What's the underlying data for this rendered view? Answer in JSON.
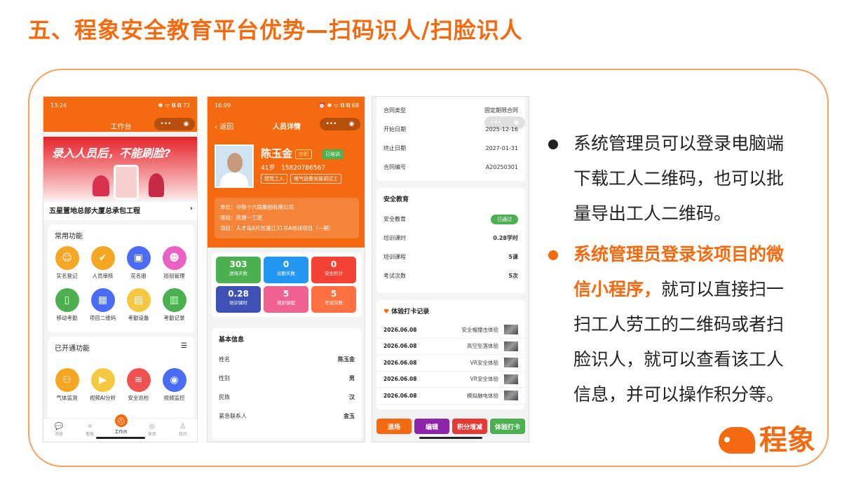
{
  "title": "五、程象安全教育平台优势—扫码识人/扫脸识人",
  "phone1": {
    "time": "13:24",
    "status_icons": "✽ ᯤ 𝗹𝗹 𝗹𝗹 73",
    "header_title": "工作台",
    "banner_text": "录入人员后，不能刷脸?",
    "project": "五星置地总部大厦总承包工程",
    "common_title": "常用功能",
    "common": [
      {
        "label": "实名登记",
        "color": "#f5a623",
        "icon": "☺"
      },
      {
        "label": "人员审核",
        "color": "#f5a623",
        "icon": "✔"
      },
      {
        "label": "花名册",
        "color": "#4a6cf7",
        "icon": "▣"
      },
      {
        "label": "班组管理",
        "color": "#e862c4",
        "icon": "☻"
      },
      {
        "label": "移动考勤",
        "color": "#4caf50",
        "icon": "▯"
      },
      {
        "label": "项目二维码",
        "color": "#4a6cf7",
        "icon": "▦"
      },
      {
        "label": "考勤设备",
        "color": "#f5c842",
        "icon": "▤"
      },
      {
        "label": "考勤记录",
        "color": "#4caf50",
        "icon": "▥"
      }
    ],
    "opened_title": "已开通功能",
    "opened": [
      {
        "label": "气体监测",
        "color": "#f5a623",
        "icon": "⚇"
      },
      {
        "label": "视频AI分析",
        "color": "#f5c842",
        "icon": "▶"
      },
      {
        "label": "安全巡检",
        "color": "#ef5350",
        "icon": "≋"
      },
      {
        "label": "视频监控",
        "color": "#4a6cf7",
        "icon": "◉"
      }
    ],
    "tabs": [
      {
        "label": "消息",
        "icon": "💬"
      },
      {
        "label": "看板",
        "icon": "⌗"
      },
      {
        "label": "工作台",
        "icon": "⛑"
      },
      {
        "label": "发现",
        "icon": "◎"
      },
      {
        "label": "我的",
        "icon": "♙"
      }
    ]
  },
  "phone2": {
    "time": "16:09",
    "status_icons": "⏰ ✽ ᯤ 𝗹𝗹 𝗹𝗹 68",
    "back": "返回",
    "nav_title": "人员详情",
    "name": "陈玉金",
    "status1": "在职",
    "status2": "已培训",
    "age": "41岁",
    "phone": "15820786567",
    "tag1": "建筑工人",
    "tag2": "电气设备安装调试工",
    "unit": "单位：中铁十六局集团有限公司",
    "team": "班组：房建一工班",
    "project": "项目：人才岛A片区蓬江31号A地块项目（一期）",
    "stats": [
      {
        "v": "303",
        "l": "进场天数",
        "c": "#4caf50"
      },
      {
        "v": "0",
        "l": "出勤天数",
        "c": "#2196f3"
      },
      {
        "v": "0",
        "l": "安全积分",
        "c": "#f44336"
      },
      {
        "v": "0.28",
        "l": "培训课时",
        "c": "#3f51b5"
      },
      {
        "v": "5",
        "l": "培训课程",
        "c": "#f06292"
      },
      {
        "v": "5",
        "l": "考试次数",
        "c": "#ff7043"
      }
    ],
    "info_title": "基本信息",
    "info": [
      {
        "k": "姓名",
        "v": "陈玉金"
      },
      {
        "k": "性别",
        "v": "男"
      },
      {
        "k": "民族",
        "v": "汉"
      },
      {
        "k": "紧急联系人",
        "v": "金玉"
      }
    ]
  },
  "phone3": {
    "contract": [
      {
        "k": "合同类型",
        "v": "固定期限合同"
      },
      {
        "k": "开始日期",
        "v": "2025-12-16"
      },
      {
        "k": "终止日期",
        "v": "2027-01-31"
      },
      {
        "k": "合同编号",
        "v": "A20250301"
      }
    ],
    "edu_title": "安全教育",
    "edu_first_k": "安全教育",
    "edu_first_v": "已通过",
    "edu": [
      {
        "k": "培训课时",
        "v": "0.28学时"
      },
      {
        "k": "培训课程",
        "v": "5课"
      },
      {
        "k": "考试次数",
        "v": "5次"
      }
    ],
    "punch_title": "体验打卡记录",
    "punch": [
      {
        "d": "2026.06.08",
        "n": "安全帽撞击体验"
      },
      {
        "d": "2026.06.08",
        "n": "高空坠落体验"
      },
      {
        "d": "2026.06.08",
        "n": "VR安全体验"
      },
      {
        "d": "2026.06.08",
        "n": "VR安全体验"
      },
      {
        "d": "2026.06.08",
        "n": "模拟触电体验"
      }
    ],
    "buttons": [
      {
        "label": "退场",
        "color": "#f36a10"
      },
      {
        "label": "编辑",
        "color": "#8e24aa"
      },
      {
        "label": "积分增减",
        "color": "#e53935"
      },
      {
        "label": "体验打卡",
        "color": "#4caf50"
      }
    ]
  },
  "bullets": [
    {
      "text": "系统管理员可以登录电脑端下载工人二维码，也可以批量导出工人二维码。",
      "color": "#222"
    },
    {
      "strong": "系统管理员登录该项目的微信小程序，",
      "text": "就可以直接扫一扫工人劳工的二维码或者扫脸识人，就可以查看该工人信息，并可以操作积分等。",
      "color": "#f36a10"
    }
  ],
  "logo_text": "程象"
}
